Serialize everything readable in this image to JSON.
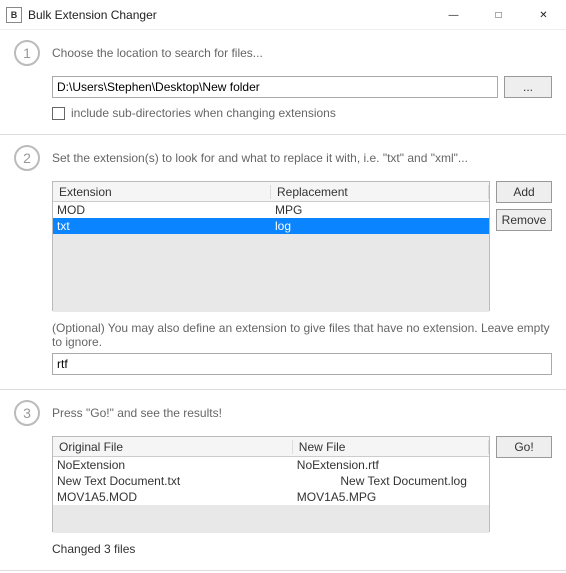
{
  "app": {
    "title": "Bulk Extension Changer",
    "icon_letter": "B"
  },
  "step1": {
    "num": "1",
    "heading": "Choose the location to search for files...",
    "path": "D:\\Users\\Stephen\\Desktop\\New folder",
    "browse": "...",
    "include_sub": "include sub-directories when changing extensions"
  },
  "step2": {
    "num": "2",
    "heading": "Set the extension(s) to look for and what to replace it with, i.e. \"txt\" and \"xml\"...",
    "col_ext": "Extension",
    "col_rep": "Replacement",
    "rows": [
      {
        "ext": "MOD",
        "rep": "MPG"
      },
      {
        "ext": "txt",
        "rep": "log"
      }
    ],
    "add": "Add",
    "remove": "Remove",
    "note": "(Optional) You may also define an extension to give files that have no extension. Leave empty to ignore.",
    "noext": "rtf"
  },
  "step3": {
    "num": "3",
    "heading": "Press \"Go!\" and see the results!",
    "col_orig": "Original File",
    "col_new": "New File",
    "rows": [
      {
        "orig": "NoExtension",
        "newf": "NoExtension.rtf"
      },
      {
        "orig": "New Text Document.txt",
        "newf": "New Text Document.log"
      },
      {
        "orig": "MOV1A5.MOD",
        "newf": "MOV1A5.MPG"
      }
    ],
    "go": "Go!",
    "status": "Changed 3 files"
  }
}
